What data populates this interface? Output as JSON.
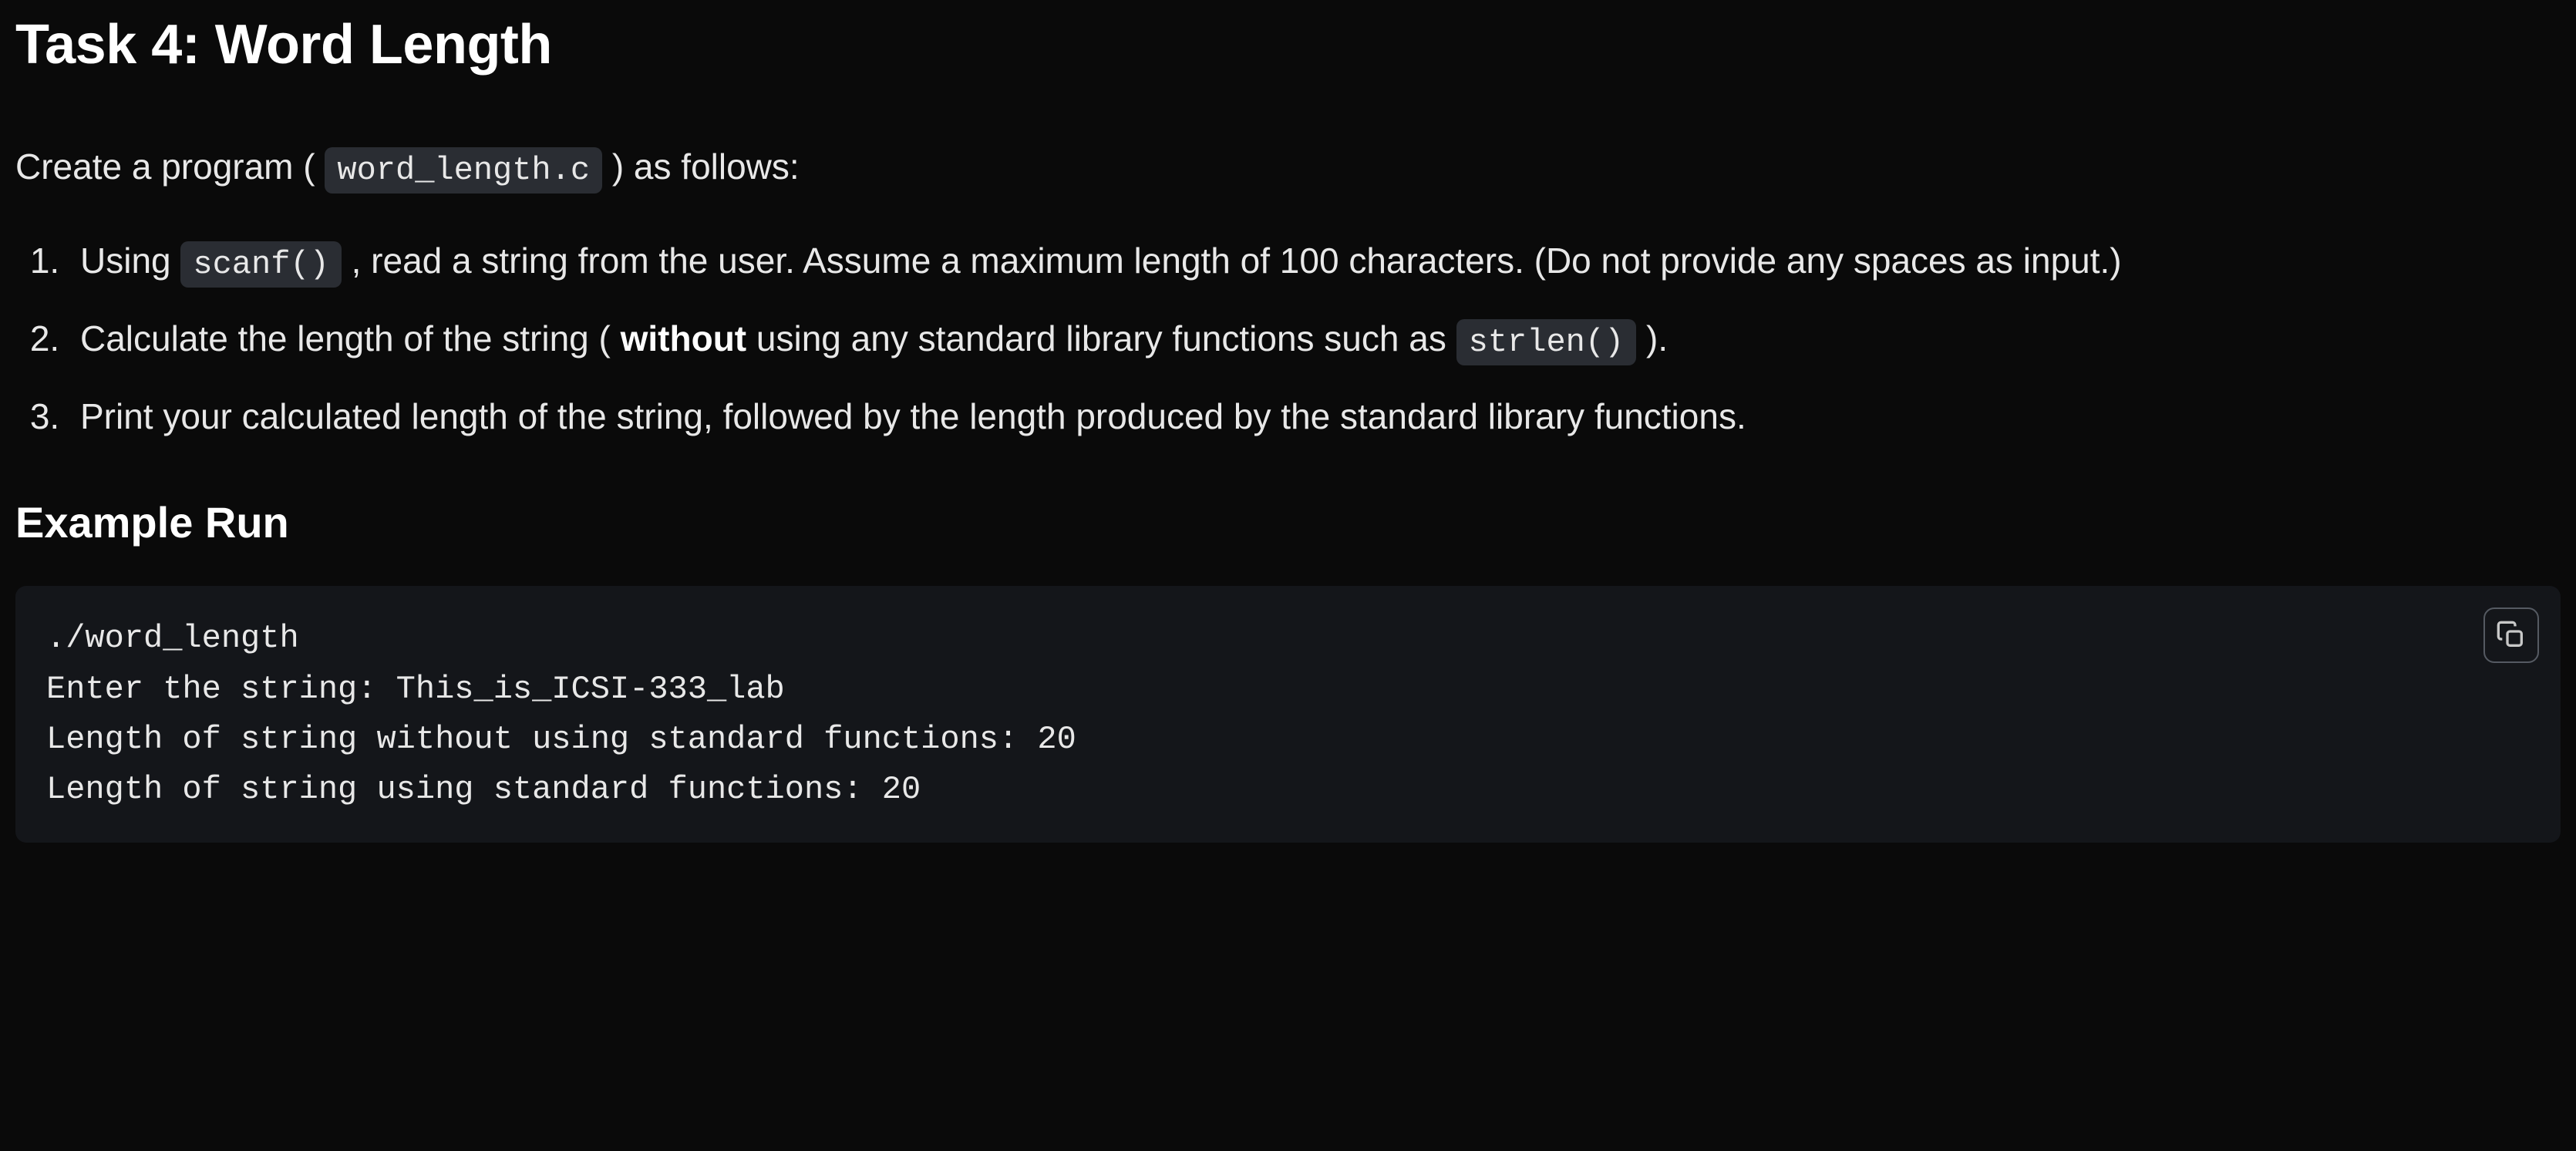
{
  "title": "Task 4: Word Length",
  "intro": {
    "prefix": "Create a program (",
    "filename": "word_length.c",
    "suffix": ") as follows:"
  },
  "steps": [
    {
      "prefix": "Using ",
      "code": "scanf()",
      "suffix": ", read a string from the user. Assume a maximum length of 100 characters. (Do not provide any spaces as input.)"
    },
    {
      "prefix": "Calculate the length of the string (",
      "bold": "without",
      "mid": " using any standard library functions such as ",
      "code": "strlen()",
      "suffix": ")."
    },
    {
      "text": "Print your calculated length of the string, followed by the length produced by the standard library functions."
    }
  ],
  "example_heading": "Example Run",
  "example_code": "./word_length\nEnter the string: This_is_ICSI-333_lab\nLength of string without using standard functions: 20\nLength of string using standard functions: 20",
  "copy_button_label": "Copy"
}
